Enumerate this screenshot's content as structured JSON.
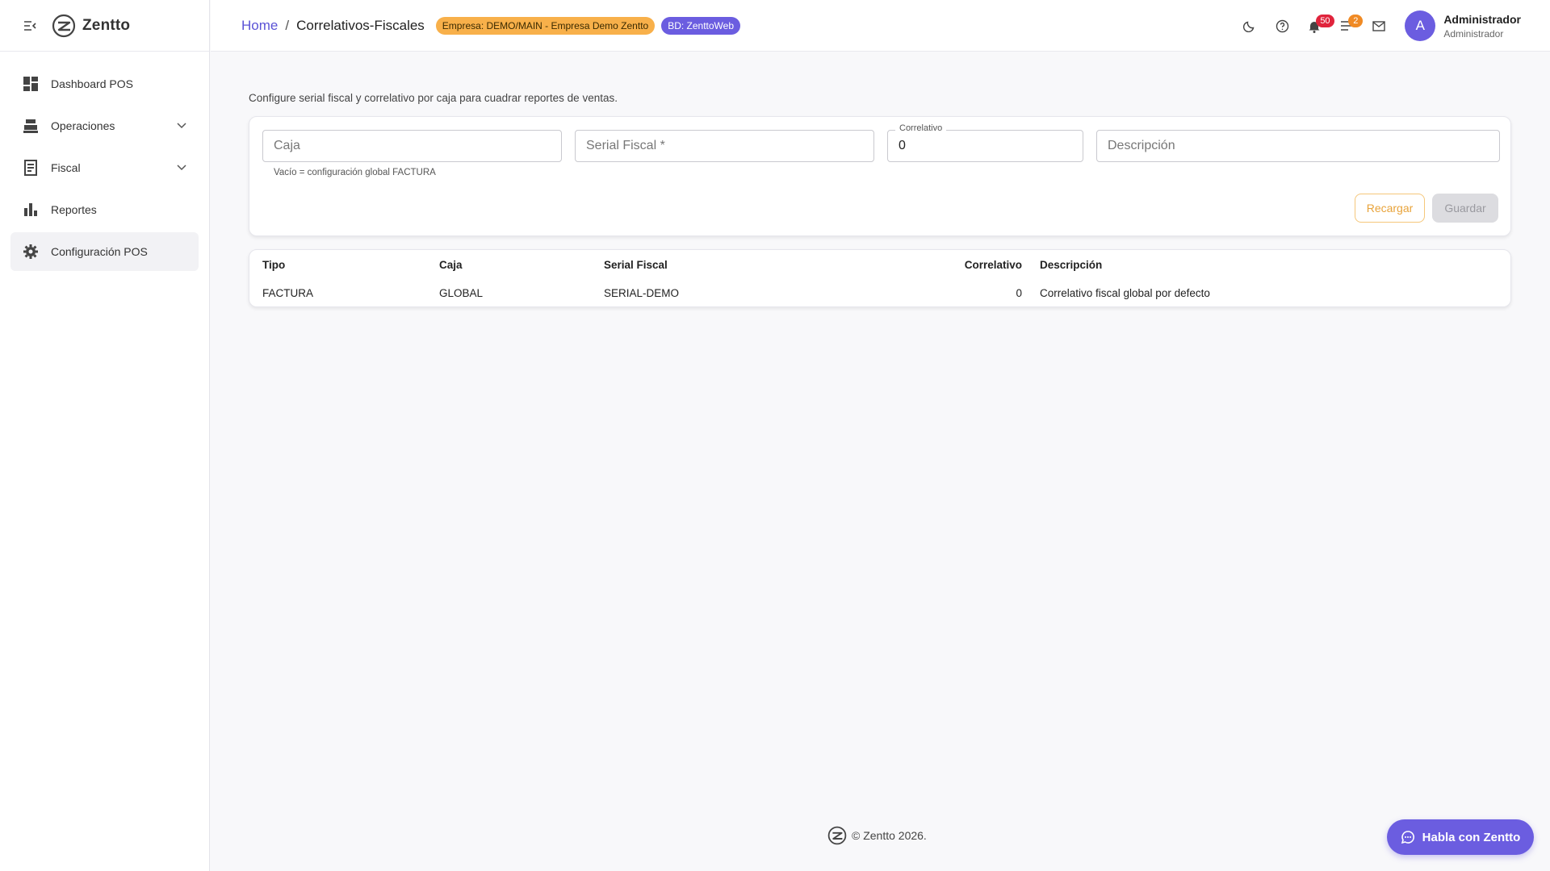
{
  "brand": {
    "name": "Zentto"
  },
  "sidebar": {
    "items": [
      {
        "label": "Dashboard POS",
        "icon": "dashboard-icon"
      },
      {
        "label": "Operaciones",
        "icon": "cash-register-icon",
        "has_children": true
      },
      {
        "label": "Fiscal",
        "icon": "receipt-icon",
        "has_children": true
      },
      {
        "label": "Reportes",
        "icon": "bar-chart-icon"
      },
      {
        "label": "Configuración POS",
        "icon": "gear-icon",
        "active": true
      }
    ]
  },
  "header": {
    "breadcrumb_home": "Home",
    "breadcrumb_sep": "/",
    "breadcrumb_current": "Correlativos-Fiscales",
    "company_badge": "Empresa: DEMO/MAIN - Empresa Demo Zentto",
    "db_badge": "BD: ZenttoWeb",
    "notifications_count": "50",
    "tasks_count": "2",
    "user_name": "Administrador",
    "user_role": "Administrador",
    "avatar_initial": "A"
  },
  "main": {
    "intro": "Configure serial fiscal y correlativo por caja para cuadrar reportes de ventas.",
    "form": {
      "caja_placeholder": "Caja",
      "caja_helper": "Vacío = configuración global FACTURA",
      "serial_placeholder": "Serial Fiscal *",
      "correlativo_label": "Correlativo",
      "correlativo_value": "0",
      "descripcion_placeholder": "Descripción",
      "reload_label": "Recargar",
      "save_label": "Guardar"
    },
    "table": {
      "headers": [
        "Tipo",
        "Caja",
        "Serial Fiscal",
        "Correlativo",
        "Descripción"
      ],
      "rows": [
        [
          "FACTURA",
          "GLOBAL",
          "SERIAL-DEMO",
          "0",
          "Correlativo fiscal global por defecto"
        ]
      ]
    }
  },
  "footer": {
    "copyright": "© Zentto 2026."
  },
  "chat": {
    "label": "Habla con Zentto"
  },
  "colors": {
    "accent": "#6b5de0",
    "warning": "#f8b04a",
    "danger": "#e0243c",
    "orange": "#f08a24"
  }
}
